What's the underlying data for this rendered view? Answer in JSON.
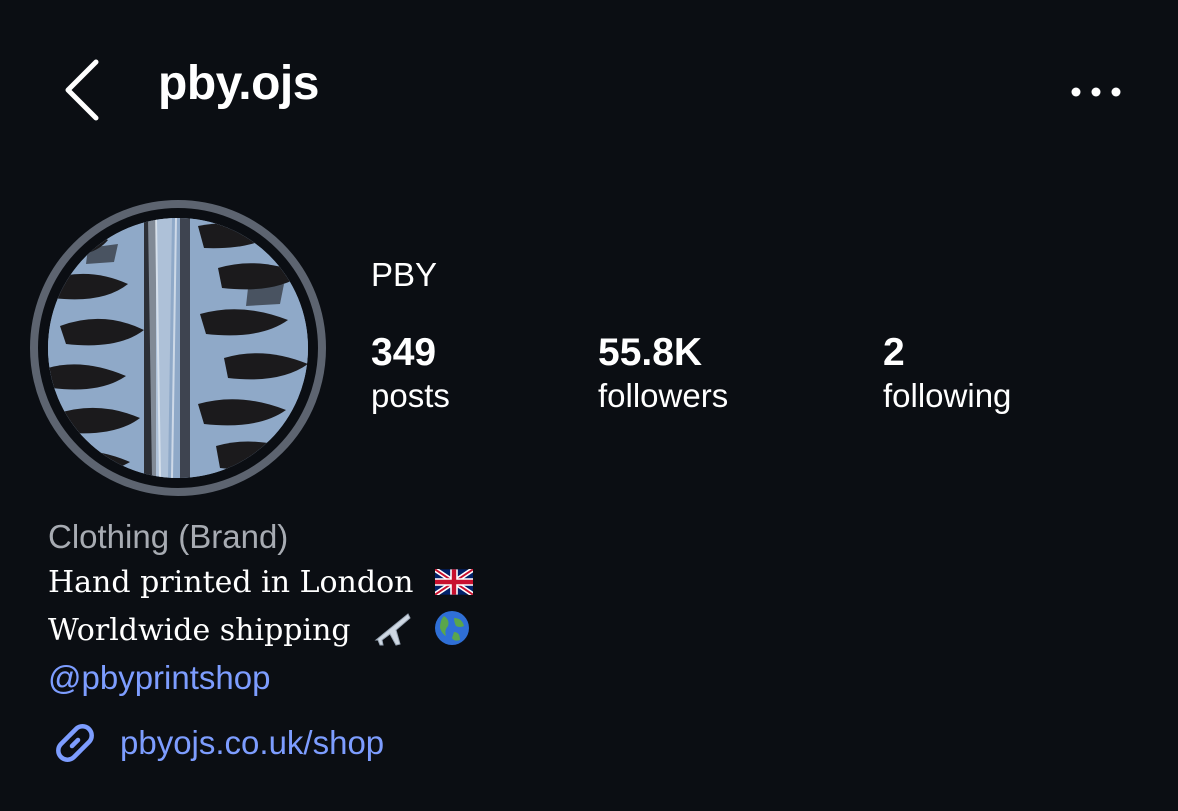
{
  "header": {
    "username": "pby.ojs",
    "back_icon": "chevron-left-icon",
    "more_icon": "more-horizontal-icon"
  },
  "profile": {
    "display_name": "PBY",
    "stats": [
      {
        "value": "349",
        "label": "posts"
      },
      {
        "value": "55.8K",
        "label": "followers"
      },
      {
        "value": "2",
        "label": "following"
      }
    ]
  },
  "bio": {
    "category": "Clothing (Brand)",
    "line1": "Hand printed in London",
    "line1_emoji": "uk-flag-emoji",
    "line2": "Worldwide shipping",
    "line2_emojis": [
      "airplane-emoji",
      "globe-emoji"
    ],
    "mention": "@pbyprintshop",
    "link": "pbyojs.co.uk/shop"
  },
  "colors": {
    "background": "#0b0e13",
    "link": "#7d9dff",
    "secondary_text": "#a7abb2",
    "avatar_ring": "#5d6470"
  }
}
